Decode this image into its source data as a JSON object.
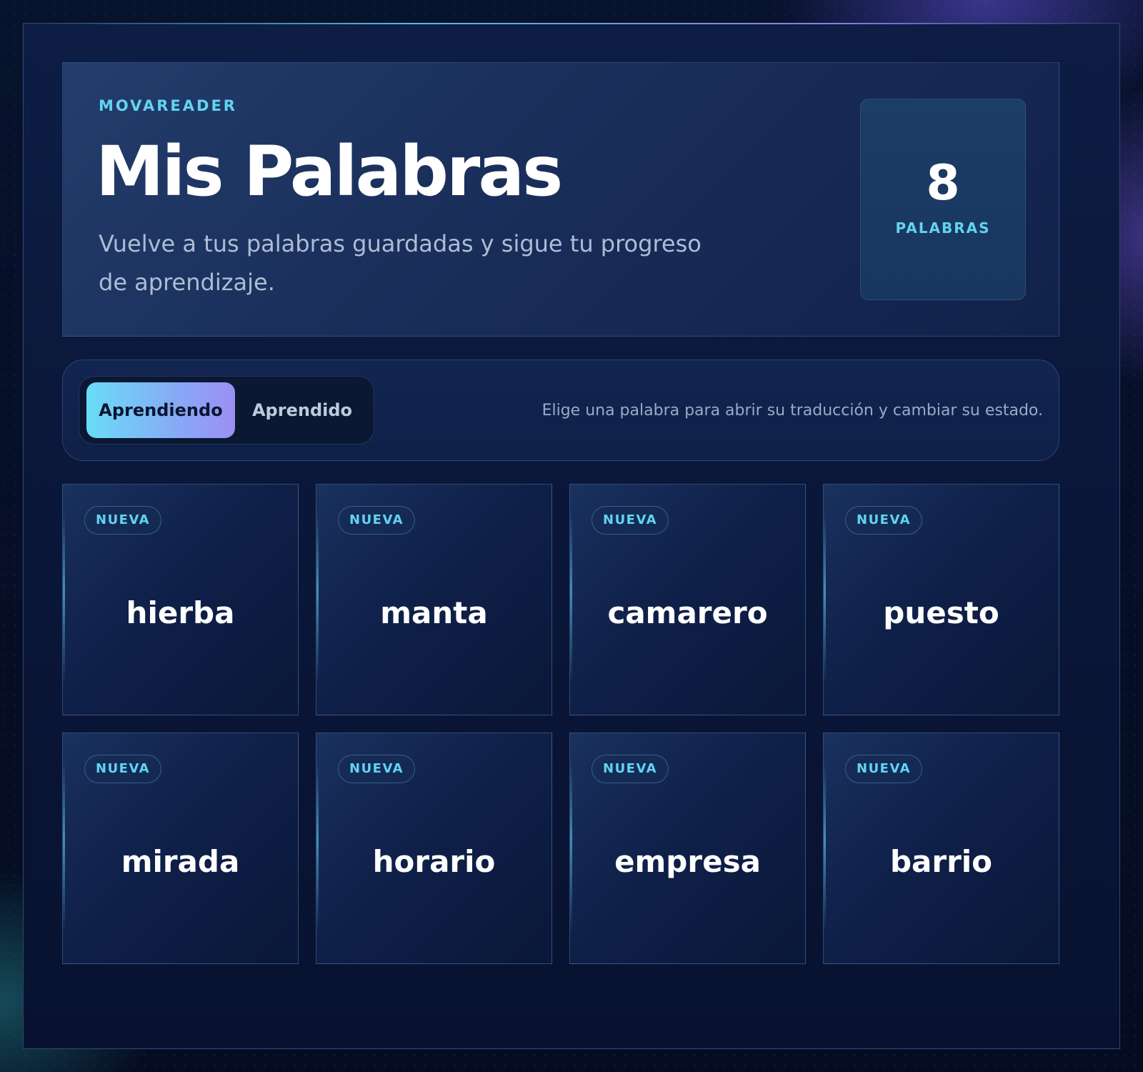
{
  "header": {
    "brand": "MOVAREADER",
    "title": "Mis Palabras",
    "subtitle": "Vuelve a tus palabras guardadas y sigue tu progreso de aprendizaje."
  },
  "counter": {
    "value": "8",
    "label": "PALABRAS"
  },
  "filters": {
    "tabs": [
      {
        "label": "Aprendiendo",
        "active": true
      },
      {
        "label": "Aprendido",
        "active": false
      }
    ],
    "hint": "Elige una palabra para abrir su traducción y cambiar su estado."
  },
  "words": [
    {
      "badge": "NUEVA",
      "word": "hierba"
    },
    {
      "badge": "NUEVA",
      "word": "manta"
    },
    {
      "badge": "NUEVA",
      "word": "camarero"
    },
    {
      "badge": "NUEVA",
      "word": "puesto"
    },
    {
      "badge": "NUEVA",
      "word": "mirada"
    },
    {
      "badge": "NUEVA",
      "word": "horario"
    },
    {
      "badge": "NUEVA",
      "word": "empresa"
    },
    {
      "badge": "NUEVA",
      "word": "barrio"
    }
  ],
  "colors": {
    "accent": "#62d3f1",
    "background": "#050d24",
    "active_tab_start": "#69dcf6",
    "active_tab_end": "#9a90f2"
  }
}
